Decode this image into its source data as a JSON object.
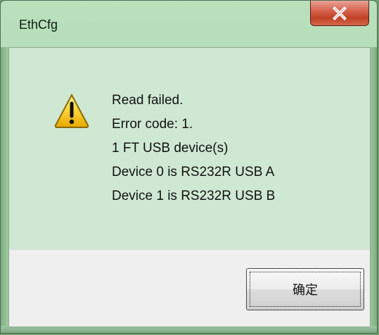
{
  "window": {
    "title": "EthCfg"
  },
  "dialog": {
    "icon": "warning-icon",
    "message_lines": [
      "Read failed.",
      "Error code: 1.",
      "1 FT USB device(s)",
      "Device 0 is RS232R USB A",
      "Device 1 is RS232R USB B"
    ],
    "ok_label": "确定"
  },
  "colors": {
    "frame": "#b9e1bd",
    "client": "#cfe8d3",
    "button_area": "#efefef",
    "close_button": "#c14226"
  }
}
